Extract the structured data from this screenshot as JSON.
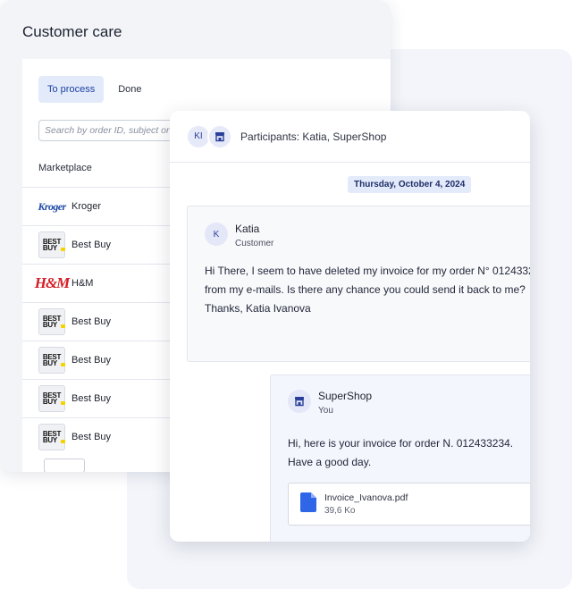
{
  "care": {
    "title": "Customer care",
    "tabs": [
      {
        "label": "To process",
        "active": true
      },
      {
        "label": "Done",
        "active": false
      }
    ],
    "search_placeholder": "Search by order ID, subject or",
    "column_header": "Marketplace",
    "rows": [
      {
        "label": "Kroger",
        "logo": "kroger-logo"
      },
      {
        "label": "Best Buy",
        "logo": "bestbuy-logo"
      },
      {
        "label": "H&M",
        "logo": "hm-logo"
      },
      {
        "label": "Best Buy",
        "logo": "bestbuy-logo"
      },
      {
        "label": "Best Buy",
        "logo": "bestbuy-logo"
      },
      {
        "label": "Best Buy",
        "logo": "bestbuy-logo"
      },
      {
        "label": "Best Buy",
        "logo": "bestbuy-logo"
      }
    ],
    "logo_text": {
      "kroger": "Kroger",
      "bestbuy_line1": "BEST",
      "bestbuy_line2": "BUY",
      "hm": "H&M"
    }
  },
  "chat": {
    "participants_avatar": "KI",
    "participants_label": "Participants: Katia, SuperShop",
    "date": "Thursday, October 4, 2024",
    "incoming": {
      "avatar": "K",
      "name": "Katia",
      "role": "Customer",
      "text": "Hi There, I seem to have deleted my invoice for my order N° 0124332\nfrom my e-mails. Is there any chance you could send it back to me?\nThanks, Katia Ivanova"
    },
    "outgoing": {
      "name": "SuperShop",
      "role": "You",
      "text": "Hi, here is your invoice for order N. 012433234.\nHave a good day.",
      "attachment": {
        "filename": "Invoice_Ivanova.pdf",
        "size": "39,6 Ko"
      }
    }
  },
  "colors": {
    "accent": "#1a3fa0",
    "accent_light": "#e3ebfb",
    "file_icon": "#2f66e8"
  }
}
